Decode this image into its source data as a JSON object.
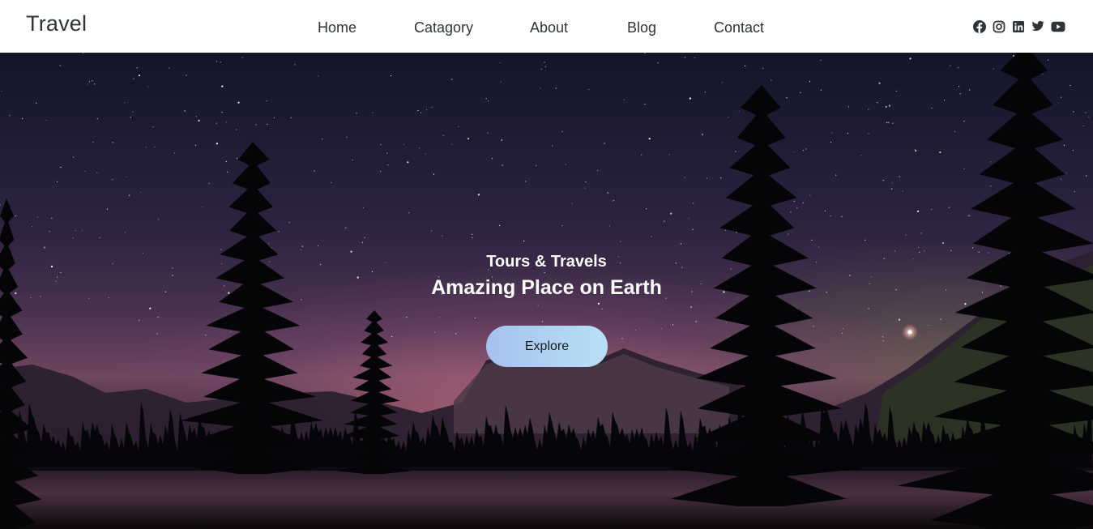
{
  "navbar": {
    "brand": "Travel",
    "links": [
      {
        "label": "Home"
      },
      {
        "label": "Catagory"
      },
      {
        "label": "About"
      },
      {
        "label": "Blog"
      },
      {
        "label": "Contact"
      }
    ],
    "social_icons": [
      "facebook-icon",
      "instagram-icon",
      "linkedin-icon",
      "twitter-icon",
      "youtube-icon"
    ]
  },
  "hero": {
    "subtitle": "Tours & Travels",
    "title": "Amazing Place on Earth",
    "cta_label": "Explore"
  },
  "colors": {
    "nav_bg": "#ffffff",
    "nav_text": "#2f3437",
    "cta_gradient_start": "#a6c1ee",
    "cta_gradient_end": "#b7e0f6",
    "hero_text": "#ffffff"
  }
}
